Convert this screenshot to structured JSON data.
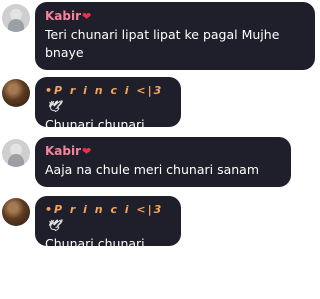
{
  "messages": [
    {
      "sender": "Kabir",
      "sender_badge": "❤",
      "text": "Teri chunari lipat lipat ke pagal Mujhe bnaye"
    },
    {
      "sender": "•P r i n c i <|3",
      "sender_badge": "🕊",
      "text": "Chunari chunari"
    },
    {
      "sender": "Kabir",
      "sender_badge": "❤",
      "text": "Aaja na chule meri chunari sanam"
    },
    {
      "sender": "•P r i n c i <|3",
      "sender_badge": "🕊",
      "text": "Chunari chunari"
    }
  ],
  "colors": {
    "bubble": "#1f1f2b",
    "kabir_name": "#f5849b",
    "princi_name": "#f2a55a"
  }
}
